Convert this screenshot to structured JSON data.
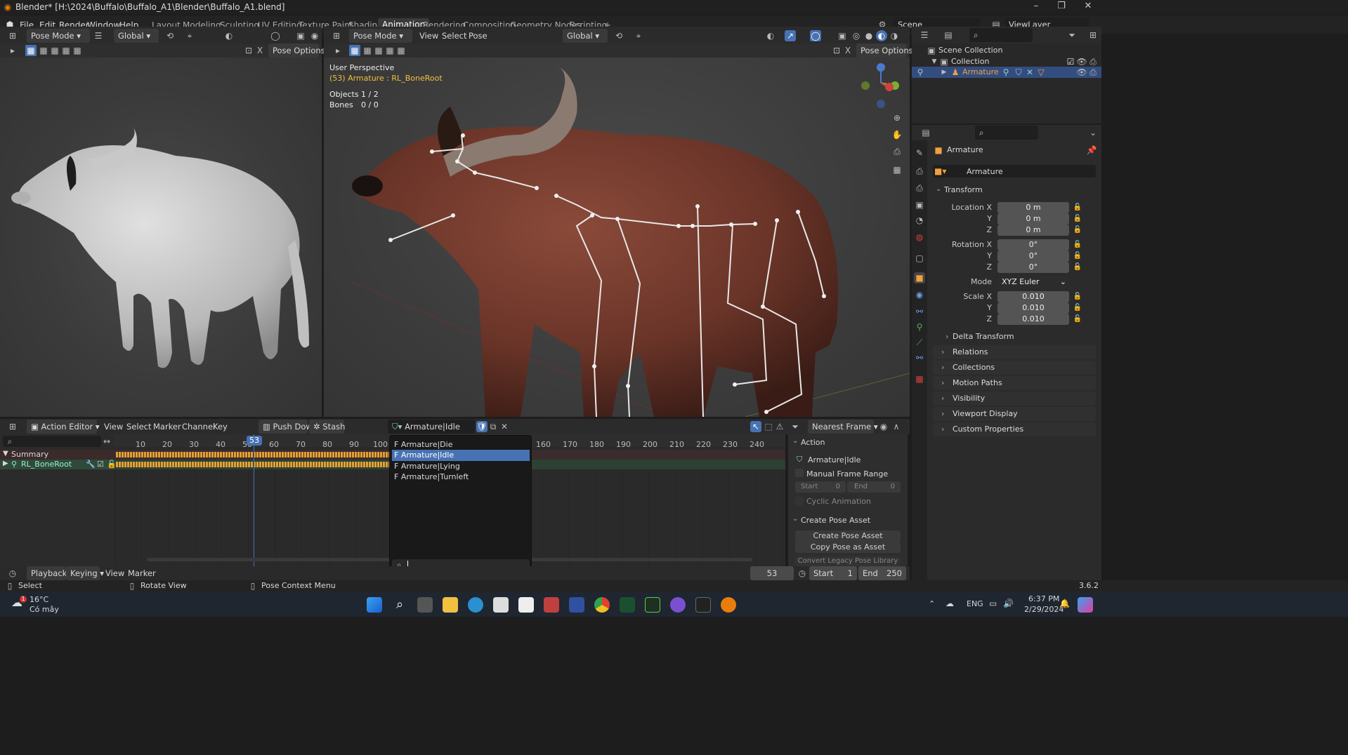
{
  "window": {
    "title": "Blender* [H:\\2024\\Buffalo\\Buffalo_A1\\Blender\\Buffalo_A1.blend]"
  },
  "menu": [
    "File",
    "Edit",
    "Render",
    "Window",
    "Help"
  ],
  "workspaces": [
    "Layout",
    "Modeling",
    "Sculpting",
    "UV Editing",
    "Texture Paint",
    "Shading",
    "Animation",
    "Rendering",
    "Compositing",
    "Geometry Nodes",
    "Scripting",
    "+"
  ],
  "active_workspace": "Animation",
  "scene": {
    "name": "Scene",
    "view_layer": "ViewLayer"
  },
  "left_viewport": {
    "mode": "Pose Mode",
    "orientation": "Global",
    "pose_options": "Pose Options"
  },
  "main_viewport": {
    "mode": "Pose Mode",
    "menu": [
      "View",
      "Select",
      "Pose"
    ],
    "orientation": "Global",
    "pose_options": "Pose Options",
    "perspective": "User Perspective",
    "active": "(53) Armature : RL_BoneRoot",
    "stats": [
      {
        "label": "Objects",
        "value": "1 / 2"
      },
      {
        "label": "Bones",
        "value": "0 / 0"
      }
    ]
  },
  "outliner": {
    "items": [
      {
        "label": "Scene Collection"
      },
      {
        "label": "Collection"
      },
      {
        "label": "Armature"
      }
    ]
  },
  "properties": {
    "object_name": "Armature",
    "datablock": "Armature",
    "transform_title": "Transform",
    "location": {
      "label": "Location X",
      "x": "0 m",
      "y": "0 m",
      "z": "0 m"
    },
    "rotation": {
      "label": "Rotation X",
      "x": "0°",
      "y": "0°",
      "z": "0°"
    },
    "mode_label": "Mode",
    "mode": "XYZ Euler",
    "scale": {
      "label": "Scale X",
      "x": "0.010",
      "y": "0.010",
      "z": "0.010"
    },
    "axis_y": "Y",
    "axis_z": "Z",
    "delta": "Delta Transform",
    "panels": [
      "Relations",
      "Collections",
      "Motion Paths",
      "Visibility",
      "Viewport Display",
      "Custom Properties"
    ]
  },
  "dopesheet": {
    "editor": "Action Editor",
    "menu": [
      "View",
      "Select",
      "Marker",
      "Channel",
      "Key"
    ],
    "push_down": "Push Down",
    "stash": "Stash",
    "action": "Armature|Idle",
    "snap": "Nearest Frame",
    "ticks": [
      "10",
      "20",
      "30",
      "40",
      "50",
      "60",
      "70",
      "80",
      "90",
      "100",
      "160",
      "170",
      "180",
      "190",
      "200",
      "210",
      "220",
      "230",
      "240"
    ],
    "current_frame": "53",
    "channels": [
      "Summary",
      "RL_BoneRoot"
    ],
    "dropdown_items": [
      "F Armature|Die",
      "F Armature|Idle",
      "F Armature|Lying",
      "F Armature|Turnleft"
    ],
    "dropdown_selected": 1,
    "side": {
      "action_title": "Action",
      "action_name": "Armature|Idle",
      "manual_range": "Manual Frame Range",
      "start_label": "Start",
      "start": "0",
      "end_label": "End",
      "end": "0",
      "cyclic": "Cyclic Animation",
      "pose_title": "Create Pose Asset",
      "create_btn": "Create Pose Asset",
      "copy_btn": "Copy Pose as Asset",
      "convert_btn": "Convert Legacy Pose Library"
    }
  },
  "timeline": {
    "menu": [
      "Playback",
      "Keying",
      "View",
      "Marker"
    ],
    "frame": "53",
    "start_label": "Start",
    "start": "1",
    "end_label": "End",
    "end": "250"
  },
  "status": {
    "select": "Select",
    "rotate": "Rotate View",
    "context": "Pose Context Menu",
    "version": "3.6.2"
  },
  "taskbar": {
    "temp": "16°C",
    "weather": "Có mây",
    "lang": "ENG",
    "time": "6:37 PM",
    "date": "2/29/2024",
    "notif": "1"
  },
  "colors": {
    "accent": "#4772b3",
    "playhead": "#4772b3",
    "key_orange": "#e8a030",
    "bg": "#1d1d1d"
  }
}
